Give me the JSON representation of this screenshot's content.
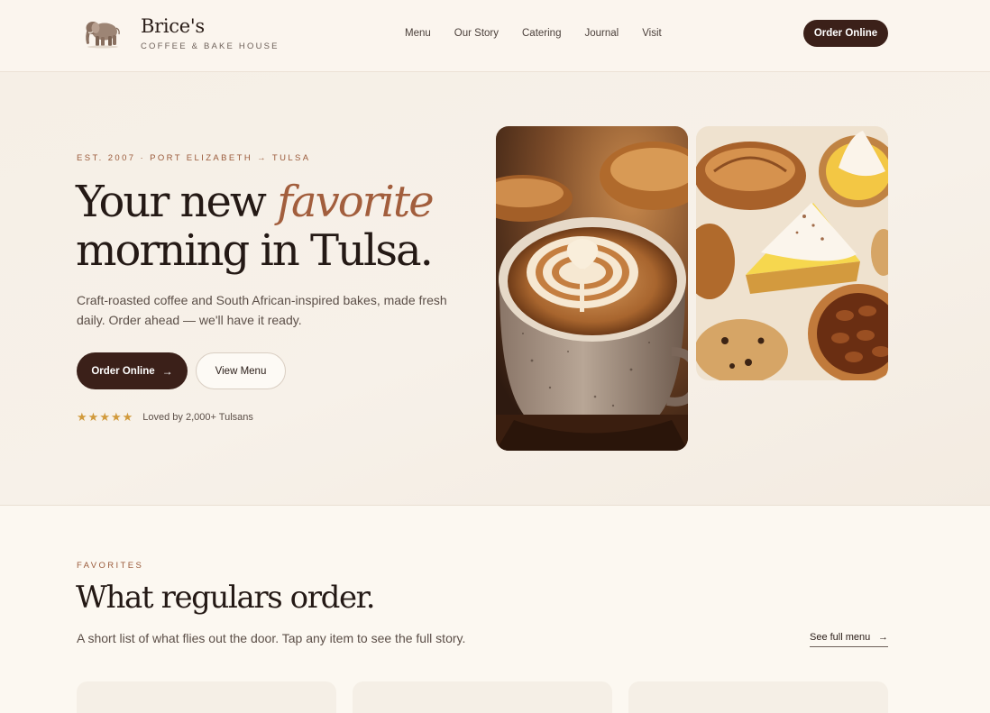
{
  "header": {
    "brand_name": "Brice's",
    "brand_tagline": "COFFEE & BAKE HOUSE",
    "nav": [
      "Menu",
      "Our Story",
      "Catering",
      "Journal",
      "Visit"
    ],
    "cta_label": "Order Online"
  },
  "hero": {
    "eyebrow": "EST. 2007 · PORT ELIZABETH → TULSA",
    "title_line1_prefix": "Your new ",
    "title_line1_accent": "favorite",
    "title_line2": "morning in Tulsa.",
    "subtitle": "Craft-roasted coffee and South African-inspired bakes, made fresh daily. Order ahead — we'll have it ready.",
    "primary_button": "Order Online",
    "secondary_button": "View Menu",
    "star_count": 5,
    "rating_text": "Loved by 2,000+ Tulsans"
  },
  "favorites": {
    "eyebrow": "FAVORITES",
    "title": "What regulars order.",
    "subtitle": "A short list of what flies out the door. Tap any item to see the full story.",
    "see_menu": "See full menu"
  },
  "icons": {
    "logo": "elephant-icon",
    "arrow": "arrow-right-icon",
    "star": "star-icon"
  },
  "colors": {
    "accent": "#a25e3d",
    "button_dark": "#3b2019",
    "star": "#d19a3c",
    "background": "#fbf7f0"
  }
}
